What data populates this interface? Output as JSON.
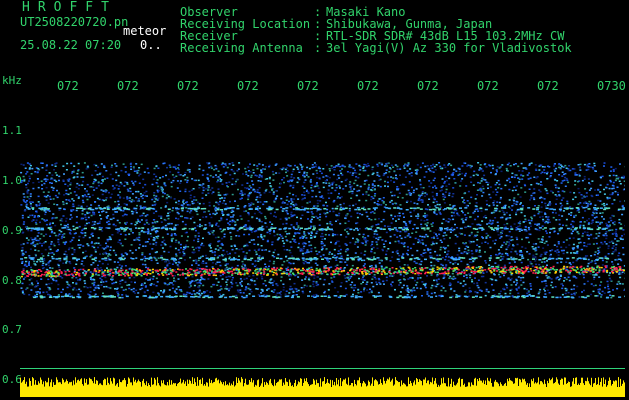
{
  "header": {
    "logo": "HROFFT",
    "filename": "UT2508220720.pn",
    "file_suffix": "meteor",
    "datetime": "25.08.22 07:20",
    "flag": "0.."
  },
  "station_info": [
    {
      "label": "Observer",
      "value": "Masaki Kano"
    },
    {
      "label": "Receiving Location",
      "value": "Shibukawa, Gunma, Japan"
    },
    {
      "label": "Receiver",
      "value": "RTL-SDR SDR# 43dB L15 103.2MHz CW"
    },
    {
      "label": "Receiving Antenna",
      "value": "3el Yagi(V) Az 330 for Vladivostok"
    }
  ],
  "colon": ":",
  "axes": {
    "y_unit": "kHz",
    "y_ticks": [
      "1.1",
      "1.0",
      "0.9",
      "0.8",
      "0.7",
      "0.6"
    ],
    "x_ticks": [
      "072",
      "072",
      "072",
      "072",
      "072",
      "072",
      "072",
      "072",
      "072",
      "0730"
    ]
  },
  "colors": {
    "text_green": "#31d36b",
    "text_white": "#ffffff",
    "signal_yellow": "#ffea00",
    "noise_blue": "#1a4cd9",
    "carrier_red": "#ff2050"
  }
}
